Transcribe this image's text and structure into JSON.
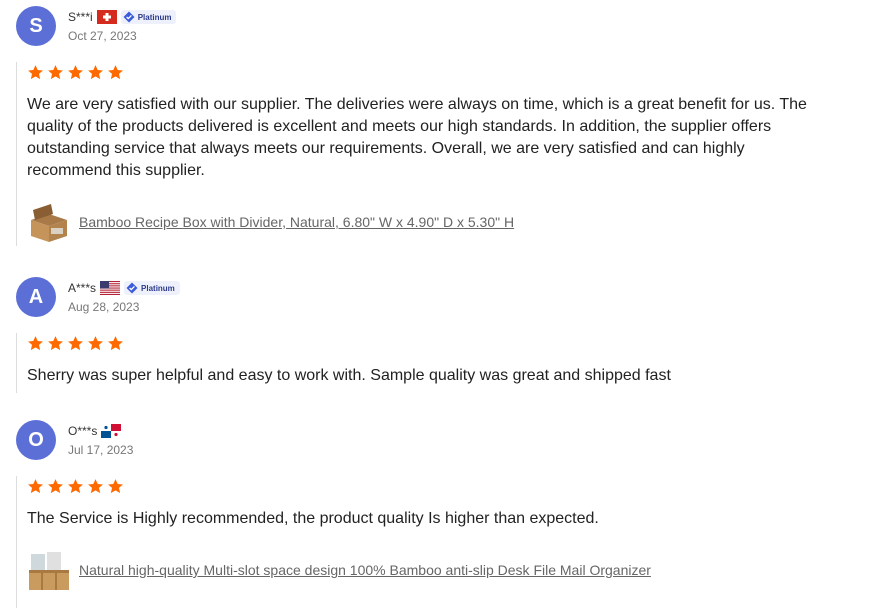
{
  "reviews": [
    {
      "initial": "S",
      "name": "S***i",
      "country_flag": "switzerland-flag",
      "badge": "Platinum",
      "date": "Oct 27, 2023",
      "rating": 5,
      "text": "We are very satisfied with our supplier. The deliveries were always on time, which is a great benefit for us. The quality of the products delivered is excellent and meets our high standards. In addition, the supplier offers outstanding service that always meets our requirements. Overall, we are very satisfied and can highly recommend this supplier.",
      "product": "Bamboo Recipe Box with Divider, Natural, 6.80\" W x 4.90\" D x 5.30\" H"
    },
    {
      "initial": "A",
      "name": "A***s",
      "country_flag": "usa-flag",
      "badge": "Platinum",
      "date": "Aug 28, 2023",
      "rating": 5,
      "text": "Sherry was super helpful and easy to work with. Sample quality was great and shipped fast"
    },
    {
      "initial": "O",
      "name": "O***s",
      "country_flag": "panama-flag",
      "date": "Jul 17, 2023",
      "rating": 5,
      "text": "The Service is Highly recommended, the product quality Is higher than expected.",
      "product": "Natural high-quality Multi-slot space design 100% Bamboo anti-slip Desk File Mail Organizer"
    }
  ],
  "colors": {
    "avatar": "#5b6fd6",
    "star": "#ff6a00",
    "badge_icon": "#3b5bdb"
  }
}
